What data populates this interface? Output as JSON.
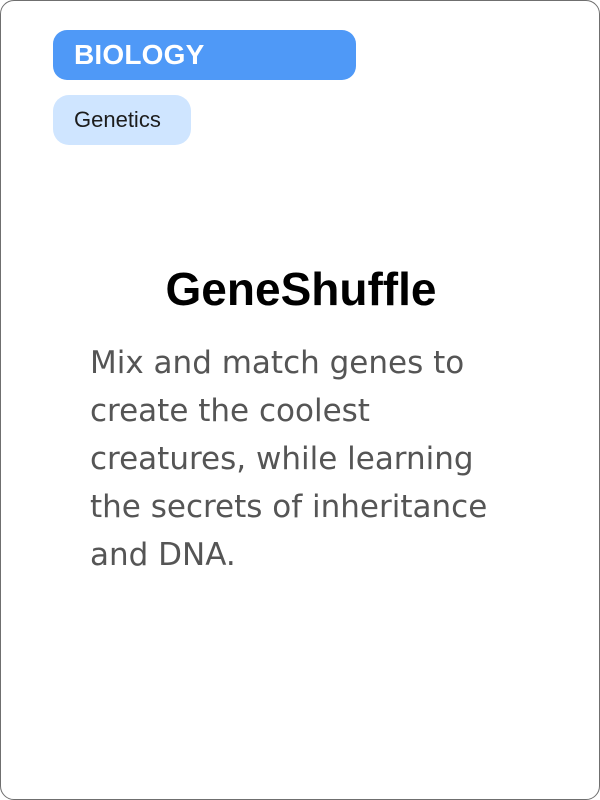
{
  "card": {
    "subject": "BIOLOGY",
    "topic": "Genetics",
    "title": "GeneShuffle",
    "description": "Mix and match genes to create the coolest creatures, while learning the secrets of inheritance and DNA."
  },
  "colors": {
    "subject_pill": "#4f99f7",
    "topic_pill": "#cfe5ff",
    "title_text": "#000000",
    "description_text": "#555555",
    "card_border": "#6f6f6f"
  }
}
